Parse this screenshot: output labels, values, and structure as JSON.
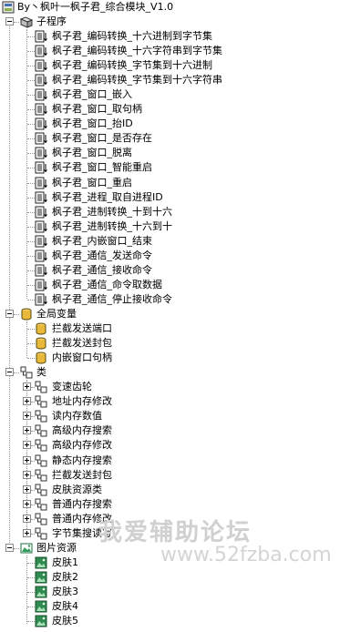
{
  "root": {
    "label": "By丶枫叶一枫子君_综合模块_V1.0",
    "icon": "module-icon"
  },
  "groups": {
    "subprograms": {
      "label": "子程序",
      "icon": "subprogram-folder-icon",
      "items": [
        "枫子君_编码转换_十六进制到字节集",
        "枫子君_编码转换_十六字符串到字节集",
        "枫子君_编码转换_字节集到十六进制",
        "枫子君_编码转换_字节集到十六字符串",
        "枫子君_窗口_嵌入",
        "枫子君_窗口_取句柄",
        "枫子君_窗口_抬ID",
        "枫子君_窗口_是否存在",
        "枫子君_窗口_脱离",
        "枫子君_窗口_智能重启",
        "枫子君_窗口_重启",
        "枫子君_进程_取自进程ID",
        "枫子君_进制转换_十到十六",
        "枫子君_进制转换_十六到十",
        "枫子君_内嵌窗口_结束",
        "枫子君_通信_发送命令",
        "枫子君_通信_接收命令",
        "枫子君_通信_命令取数据",
        "枫子君_通信_停止接收命令"
      ]
    },
    "globals": {
      "label": "全局变量",
      "icon": "database-icon",
      "items": [
        "拦截发送端口",
        "拦截发送封包",
        "内嵌窗口句柄"
      ]
    },
    "classes": {
      "label": "类",
      "icon": "class-icon",
      "items": [
        "变速齿轮",
        "地址内存修改",
        "读内存数值",
        "高级内存搜索",
        "高级内存修改",
        "静态内存搜索",
        "拦截发送封包",
        "皮肤资源类",
        "普通内存搜索",
        "普通内存修改",
        "字节集搜读写"
      ]
    },
    "images": {
      "label": "图片资源",
      "icon": "image-folder-icon",
      "items": [
        "皮肤1",
        "皮肤2",
        "皮肤3",
        "皮肤4",
        "皮肤5"
      ]
    }
  },
  "watermark": {
    "title": "我爱辅助论坛",
    "url": "www.52fzba.com"
  },
  "colors": {
    "selection": "#000080",
    "tree_line": "#9a9a9a",
    "watermark": "#cfcfcf"
  }
}
